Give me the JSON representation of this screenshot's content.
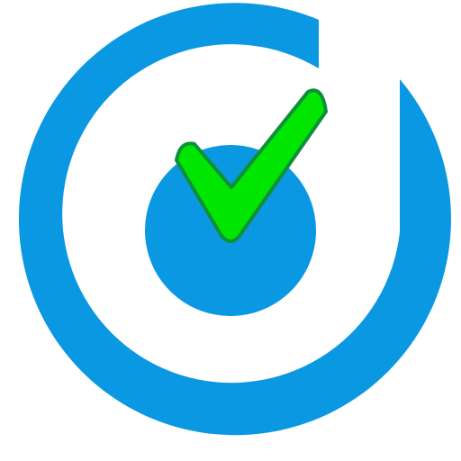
{
  "logo": {
    "icon": "target-check-icon",
    "colors": {
      "background": "#ffffff",
      "ring": "#0A98E2",
      "center": "#0A98E2",
      "check": "#00E600",
      "check_outline": "#0E8F3A"
    }
  }
}
